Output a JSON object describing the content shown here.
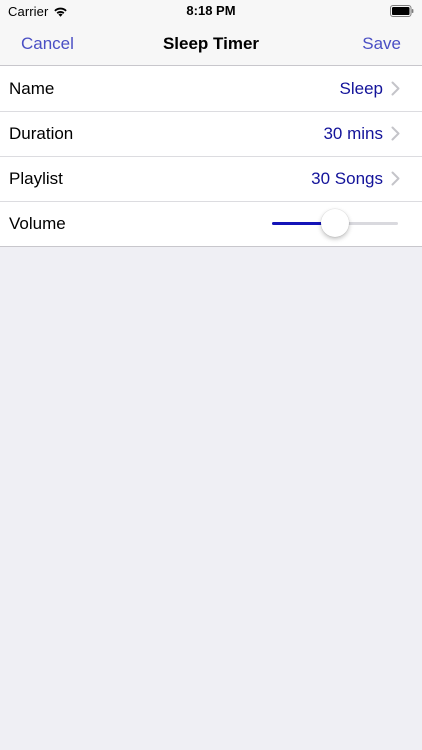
{
  "status_bar": {
    "carrier": "Carrier",
    "time": "8:18 PM",
    "wifi_icon": "wifi-icon",
    "battery_icon": "battery-full-icon"
  },
  "nav": {
    "cancel_label": "Cancel",
    "title": "Sleep Timer",
    "save_label": "Save",
    "accent_color": "#4a4fc4"
  },
  "settings": {
    "rows": [
      {
        "label": "Name",
        "value": "Sleep"
      },
      {
        "label": "Duration",
        "value": "30 mins"
      },
      {
        "label": "Playlist",
        "value": "30 Songs"
      },
      {
        "label": "Volume"
      }
    ],
    "value_color": "#13139a",
    "chevron_icon": "chevron-right-icon"
  },
  "volume": {
    "level": 0.5,
    "fill_color": "#1414b8"
  }
}
